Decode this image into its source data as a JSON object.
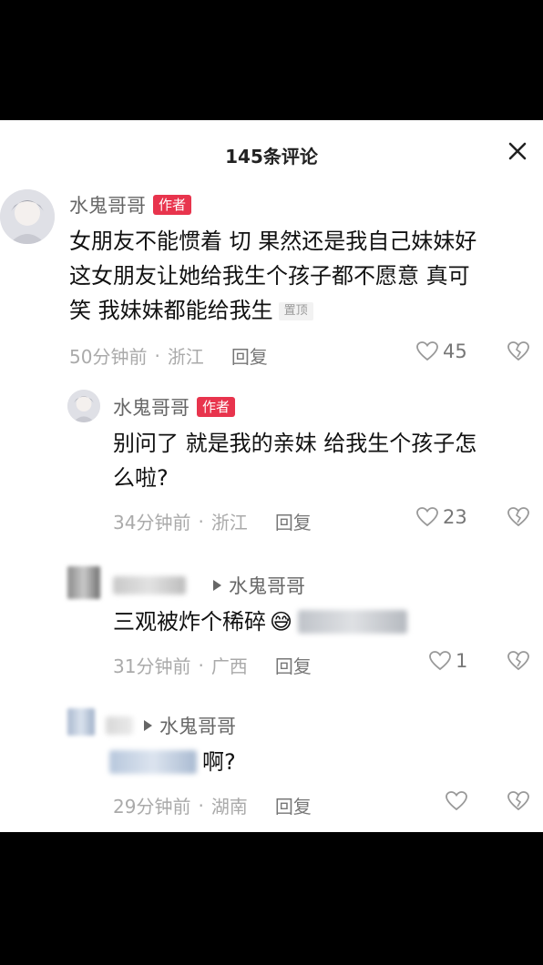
{
  "header": {
    "title": "145条评论"
  },
  "comments": [
    {
      "author": "水鬼哥哥",
      "badge": "作者",
      "text_line1": "女朋友不能惯着 切 果然还是我自己妹妹好",
      "text_line2": "这女朋友让她给我生个孩子都不愿意 真可",
      "text_line3": "笑 我妹妹都能给我生",
      "pinned": "置顶",
      "time": "50分钟前",
      "location": "浙江",
      "reply_label": "回复",
      "likes": "45"
    },
    {
      "author": "水鬼哥哥",
      "badge": "作者",
      "text_line1": "别问了 就是我的亲妹 给我生个孩子怎",
      "text_line2": "么啦?",
      "time": "34分钟前",
      "location": "浙江",
      "reply_label": "回复",
      "likes": "23"
    },
    {
      "reply_to": "水鬼哥哥",
      "text": "三观被炸个稀碎",
      "emoji": "😅",
      "time": "31分钟前",
      "location": "广西",
      "reply_label": "回复",
      "likes": "1"
    },
    {
      "reply_to": "水鬼哥哥",
      "text": "啊?",
      "time": "29分钟前",
      "location": "湖南",
      "reply_label": "回复"
    }
  ],
  "icons": {
    "close": "close-icon",
    "heart": "heart-icon",
    "dislike": "dislike-icon",
    "reply_arrow": "triangle-right-icon"
  },
  "colors": {
    "badge": "#e8344d",
    "background": "#ffffff"
  }
}
